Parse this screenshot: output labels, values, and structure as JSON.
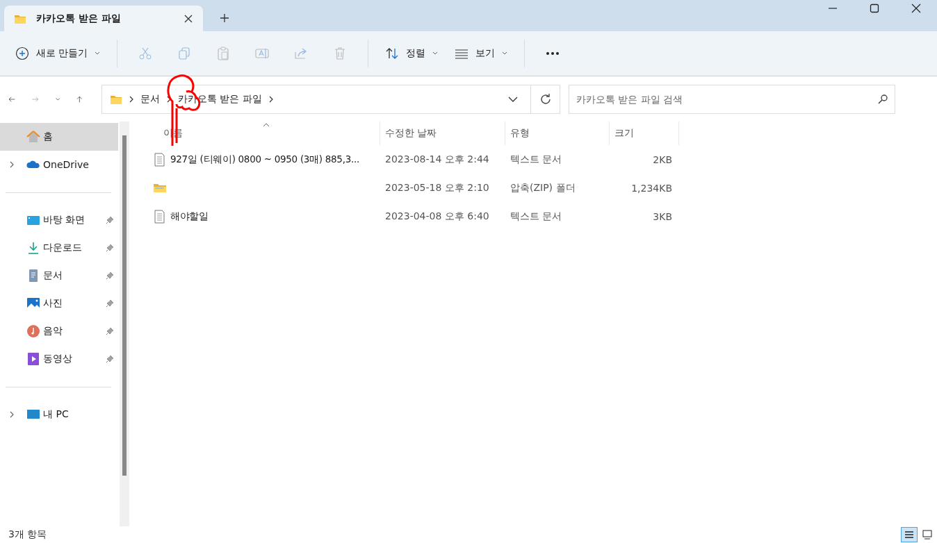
{
  "window": {
    "tab_title": "카카오톡 받은 파일"
  },
  "toolbar": {
    "new_button": {
      "label": "새로 만들기"
    },
    "actions": [
      {
        "kind": "cut",
        "disabled": true
      },
      {
        "kind": "copy",
        "disabled": true
      },
      {
        "kind": "paste",
        "disabled": true
      },
      {
        "kind": "rename",
        "disabled": true
      },
      {
        "kind": "share",
        "disabled": true
      },
      {
        "kind": "delete",
        "disabled": true
      }
    ],
    "sort_button": {
      "label": "정렬"
    },
    "view_button": {
      "label": "보기"
    }
  },
  "address_bar": {
    "crumbs": [
      "문서",
      "카카오톡 받은 파일"
    ]
  },
  "search": {
    "placeholder": "카카오톡 받은 파일 검색"
  },
  "sidebar": {
    "items": [
      {
        "kind": "home",
        "label": "홈",
        "selected": true,
        "expandable": false,
        "pinned": false
      },
      {
        "kind": "cloud",
        "label": "OneDrive",
        "selected": false,
        "expandable": true,
        "pinned": false
      },
      {
        "kind": "divider"
      },
      {
        "kind": "desktop",
        "label": "바탕 화면",
        "selected": false,
        "expandable": false,
        "pinned": true
      },
      {
        "kind": "download",
        "label": "다운로드",
        "selected": false,
        "expandable": false,
        "pinned": true
      },
      {
        "kind": "document",
        "label": "문서",
        "selected": false,
        "expandable": false,
        "pinned": true
      },
      {
        "kind": "photo",
        "label": "사진",
        "selected": false,
        "expandable": false,
        "pinned": true
      },
      {
        "kind": "music",
        "label": "음악",
        "selected": false,
        "expandable": false,
        "pinned": true
      },
      {
        "kind": "video",
        "label": "동영상",
        "selected": false,
        "expandable": false,
        "pinned": true
      },
      {
        "kind": "divider"
      },
      {
        "kind": "pc",
        "label": "내 PC",
        "selected": false,
        "expandable": true,
        "pinned": false
      }
    ]
  },
  "table": {
    "columns": [
      "이름",
      "수정한 날짜",
      "유형",
      "크기"
    ],
    "rows": [
      {
        "kind": "text",
        "name": "927일 (티웨이) 0800 ~ 0950 (3매) 885,3...",
        "date": "2023-08-14 오후 2:44",
        "type": "텍스트 문서",
        "size": "2KB"
      },
      {
        "kind": "zip",
        "date": "2023-05-18 오후 2:10",
        "type": "압축(ZIP) 폴더",
        "size": "1,234KB"
      },
      {
        "kind": "text",
        "name": "해야할일",
        "date": "2023-04-08 오후 6:40",
        "type": "텍스트 문서",
        "size": "3KB"
      }
    ]
  },
  "status_bar": {
    "count": "3개 항목",
    "views": [
      {
        "kind": "details",
        "selected": true
      },
      {
        "kind": "tiles",
        "selected": false
      }
    ]
  }
}
